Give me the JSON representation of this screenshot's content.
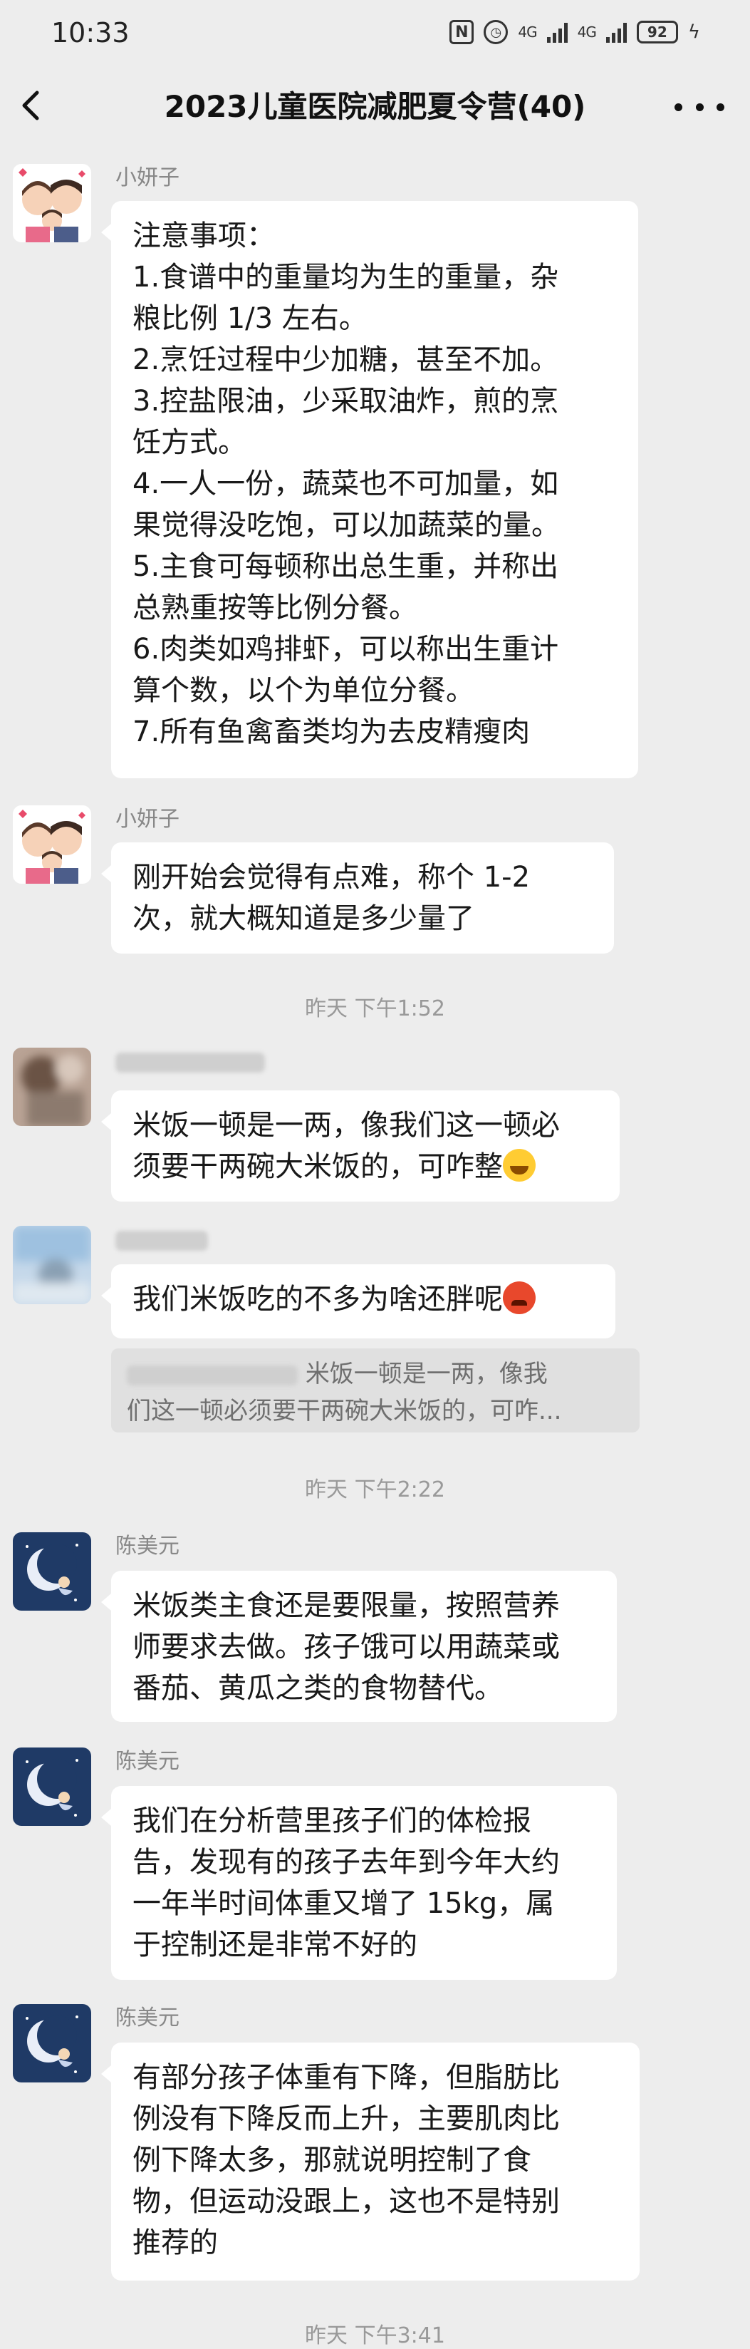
{
  "status_bar": {
    "time": "10:33",
    "network_1": "4G",
    "network_2": "4G",
    "battery": "92"
  },
  "nav": {
    "title": "2023儿童医院减肥夏令营(40)"
  },
  "messages": [
    {
      "sender": "小妍子",
      "avatar": "cartoon-family-avatar",
      "lines": [
        "注意事项：",
        "1.食谱中的重量均为生的重量，杂",
        "粮比例 1/3 左右。",
        "2.烹饪过程中少加糖，甚至不加。",
        "3.控盐限油，少采取油炸，煎的烹",
        "饪方式。",
        "4.一人一份，蔬菜也不可加量，如",
        "果觉得没吃饱，可以加蔬菜的量。",
        "5.主食可每顿称出总生重，并称出",
        "总熟重按等比例分餐。",
        "6.肉类如鸡排虾，可以称出生重计",
        "算个数，以个为单位分餐。",
        "7.所有鱼禽畜类均为去皮精瘦肉"
      ]
    },
    {
      "sender": "小妍子",
      "avatar": "cartoon-family-avatar",
      "lines": [
        "刚开始会觉得有点难，称个 1-2",
        "次，就大概知道是多少量了"
      ]
    },
    {
      "timestamp": "昨天 下午1:52"
    },
    {
      "avatar": "blurred-avatar",
      "lines": [
        "米饭一顿是一两，像我们这一顿必",
        "须要干两碗大米饭的，可咋整"
      ],
      "emoji": "laughing-emoji"
    },
    {
      "avatar": "blurred-avatar",
      "lines": [
        "我们米饭吃的不多为啥还胖呢"
      ],
      "emoji": "angry-emoji",
      "quote": {
        "line1": "米饭一顿是一两，像我",
        "line2": "们这一顿必须要干两碗大米饭的，可咋..."
      }
    },
    {
      "timestamp": "昨天 下午2:22"
    },
    {
      "sender": "陈美元",
      "avatar": "moon-avatar",
      "lines": [
        "米饭类主食还是要限量，按照营养",
        "师要求去做。孩子饿可以用蔬菜或",
        "番茄、黄瓜之类的食物替代。"
      ]
    },
    {
      "sender": "陈美元",
      "avatar": "moon-avatar",
      "lines": [
        "我们在分析营里孩子们的体检报",
        "告，发现有的孩子去年到今年大约",
        "一年半时间体重又增了 15kg，属",
        "于控制还是非常不好的"
      ]
    },
    {
      "sender": "陈美元",
      "avatar": "moon-avatar",
      "lines": [
        "有部分孩子体重有下降，但脂肪比",
        "例没有下降反而上升，主要肌肉比",
        "例下降太多，那就说明控制了食",
        "物，但运动没跟上，这也不是特别",
        "推荐的"
      ]
    },
    {
      "timestamp": "昨天 下午3:41"
    }
  ]
}
